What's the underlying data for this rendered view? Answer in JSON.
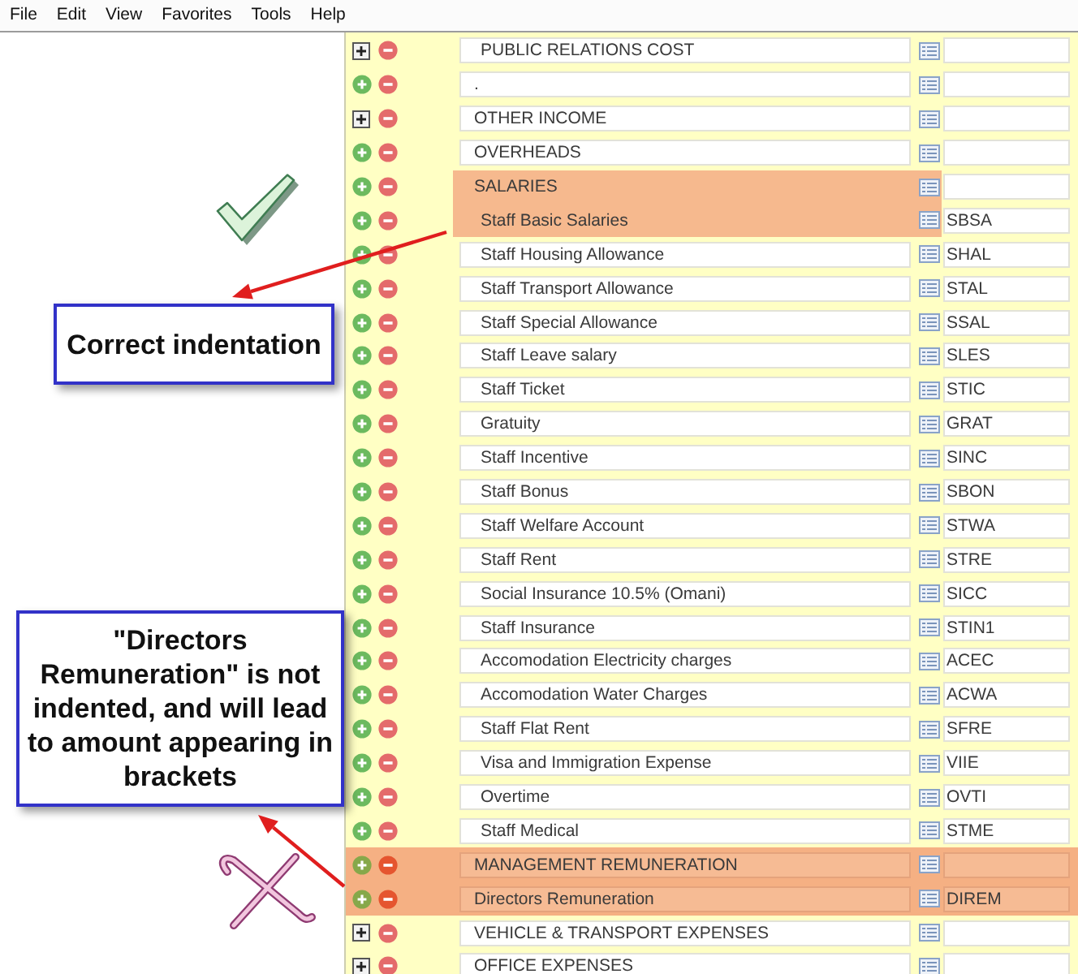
{
  "menu_bar": {
    "items": [
      "File",
      "Edit",
      "View",
      "Favorites",
      "Tools",
      "Help"
    ]
  },
  "tree": {
    "rows": [
      {
        "name": "PUBLIC RELATIONS COST",
        "expandable": true,
        "indented": true,
        "highlighted": false
      },
      {
        "name": ".",
        "expandable": false,
        "indented": false,
        "highlighted": false
      },
      {
        "name": "OTHER INCOME",
        "expandable": true,
        "indented": false,
        "highlighted": false
      },
      {
        "name": "OVERHEADS",
        "expandable": false,
        "indented": false,
        "highlighted": false
      },
      {
        "name": "SALARIES",
        "expandable": false,
        "indented": false,
        "highlighted": true,
        "highlight_covers_icons": false
      },
      {
        "name": "Staff Basic Salaries",
        "code": "SBSA",
        "expandable": false,
        "indented": true,
        "highlighted": true,
        "highlight_covers_icons": false
      },
      {
        "name": "Staff Housing Allowance",
        "code": "SHAL",
        "expandable": false,
        "indented": true,
        "highlighted": false
      },
      {
        "name": "Staff Transport Allowance",
        "code": "STAL",
        "expandable": false,
        "indented": true,
        "highlighted": false
      },
      {
        "name": "Staff Special Allowance",
        "code": "SSAL",
        "expandable": false,
        "indented": true,
        "highlighted": false
      },
      {
        "name": "Staff Leave salary",
        "code": "SLES",
        "expandable": false,
        "indented": true,
        "highlighted": false
      },
      {
        "name": "Staff Ticket",
        "code": "STIC",
        "expandable": false,
        "indented": true,
        "highlighted": false
      },
      {
        "name": "Gratuity",
        "code": "GRAT",
        "expandable": false,
        "indented": true,
        "highlighted": false
      },
      {
        "name": "Staff Incentive",
        "code": "SINC",
        "expandable": false,
        "indented": true,
        "highlighted": false
      },
      {
        "name": "Staff Bonus",
        "code": "SBON",
        "expandable": false,
        "indented": true,
        "highlighted": false
      },
      {
        "name": "Staff Welfare Account",
        "code": "STWA",
        "expandable": false,
        "indented": true,
        "highlighted": false
      },
      {
        "name": "Staff Rent",
        "code": "STRE",
        "expandable": false,
        "indented": true,
        "highlighted": false
      },
      {
        "name": "Social Insurance 10.5% (Omani)",
        "code": "SICC",
        "expandable": false,
        "indented": true,
        "highlighted": false
      },
      {
        "name": "Staff Insurance",
        "code": "STIN1",
        "expandable": false,
        "indented": true,
        "highlighted": false
      },
      {
        "name": "Accomodation Electricity charges",
        "code": "ACEC",
        "expandable": false,
        "indented": true,
        "highlighted": false
      },
      {
        "name": "Accomodation Water Charges",
        "code": "ACWA",
        "expandable": false,
        "indented": true,
        "highlighted": false
      },
      {
        "name": "Staff Flat Rent",
        "code": "SFRE",
        "expandable": false,
        "indented": true,
        "highlighted": false
      },
      {
        "name": "Visa and Immigration Expense",
        "code": "VIIE",
        "expandable": false,
        "indented": true,
        "highlighted": false
      },
      {
        "name": "Overtime",
        "code": "OVTI",
        "expandable": false,
        "indented": true,
        "highlighted": false
      },
      {
        "name": "Staff Medical",
        "code": "STME",
        "expandable": false,
        "indented": true,
        "highlighted": false
      },
      {
        "name": "MANAGEMENT REMUNERATION",
        "expandable": false,
        "indented": false,
        "highlighted": true,
        "highlight_covers_icons": true
      },
      {
        "name": "Directors Remuneration",
        "code": "DIREM",
        "expandable": false,
        "indented": false,
        "highlighted": true,
        "highlight_covers_icons": true
      },
      {
        "name": "VEHICLE & TRANSPORT EXPENSES",
        "expandable": true,
        "indented": false,
        "highlighted": false
      },
      {
        "name": "OFFICE EXPENSES",
        "expandable": true,
        "indented": false,
        "highlighted": false
      }
    ]
  },
  "annotations": {
    "callouts": [
      {
        "text": "Correct indentation",
        "correct": true
      },
      {
        "text": "\"Directors Remuneration\" is not indented, and will lead to amount appearing in brackets",
        "correct": false
      }
    ]
  }
}
